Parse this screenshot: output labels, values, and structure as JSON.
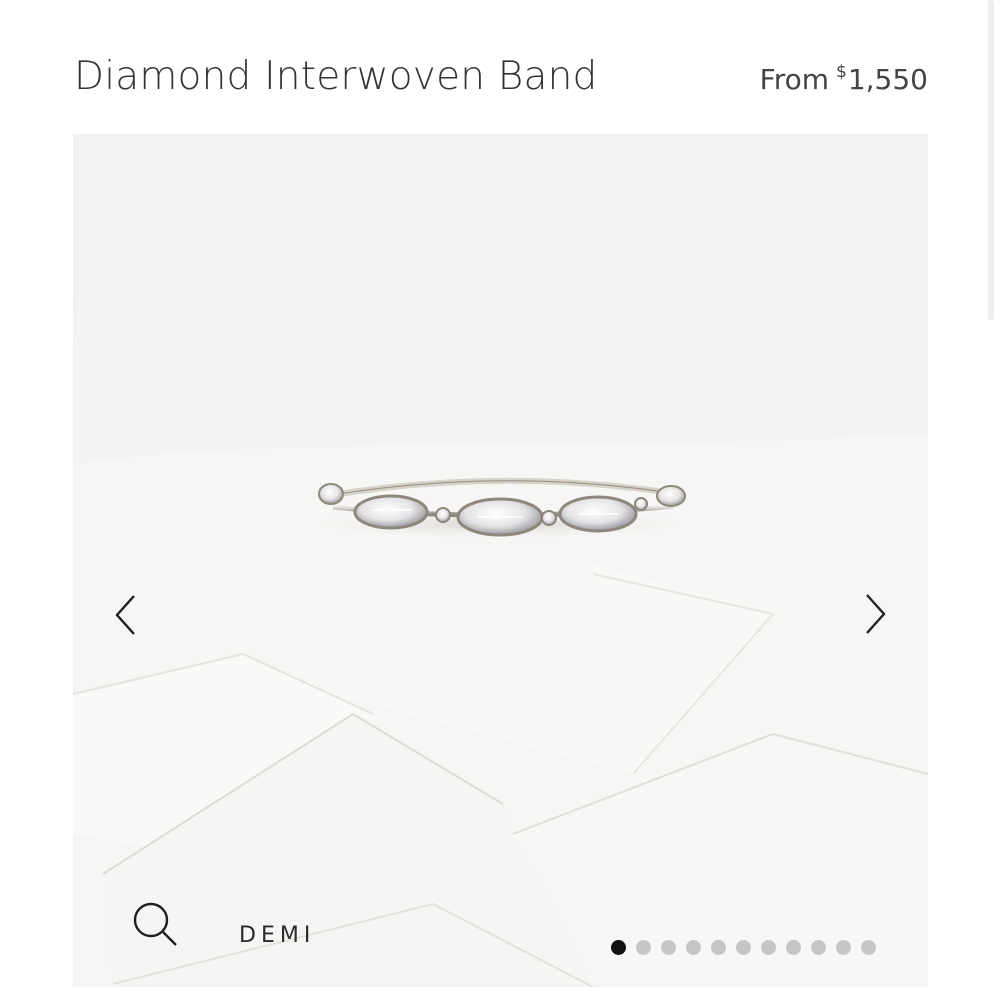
{
  "product": {
    "title": "Diamond Interwoven Band",
    "price_prefix": "From",
    "price_currency": "$",
    "price_value": "1,550"
  },
  "gallery": {
    "badge": "DEMI",
    "slide_count": 11,
    "active_slide": 1,
    "icons": {
      "prev": "chevron-left-icon",
      "next": "chevron-right-icon",
      "zoom": "search-icon"
    }
  },
  "colors": {
    "text": "#333333",
    "active_dot": "#111111",
    "inactive_dot": "#c6c6c6"
  }
}
